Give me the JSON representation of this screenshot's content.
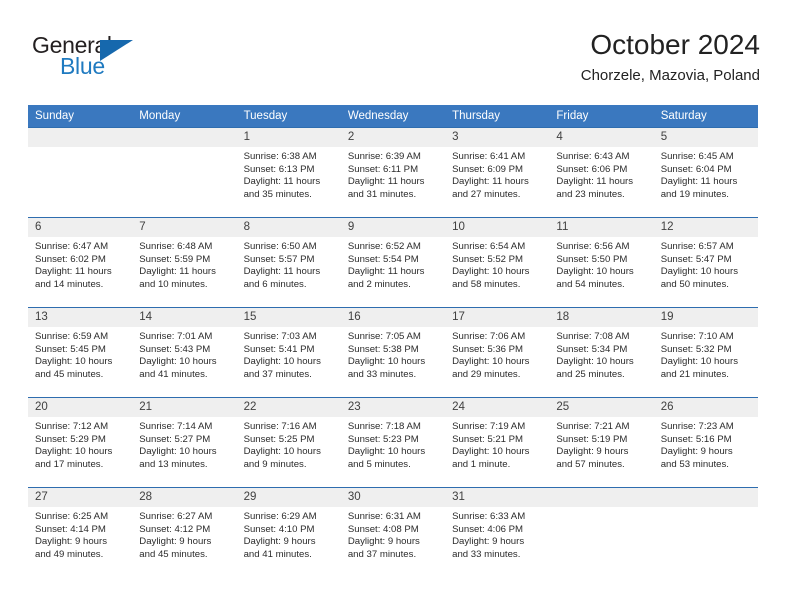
{
  "brand": {
    "name_part1": "General",
    "name_part2": "Blue",
    "flag_icon": "triangle-flag-icon"
  },
  "header": {
    "title": "October 2024",
    "location": "Chorzele, Mazovia, Poland"
  },
  "colors": {
    "header_blue": "#3a78bf",
    "rule_blue": "#2e6daf",
    "day_band": "#efefef",
    "brand_blue": "#1f7ac0"
  },
  "calendar": {
    "weekday_headers": [
      "Sunday",
      "Monday",
      "Tuesday",
      "Wednesday",
      "Thursday",
      "Friday",
      "Saturday"
    ],
    "weeks": [
      [
        {
          "day": "",
          "blank": true
        },
        {
          "day": "",
          "blank": true
        },
        {
          "day": "1",
          "sunrise": "Sunrise: 6:38 AM",
          "sunset": "Sunset: 6:13 PM",
          "daylight_line1": "Daylight: 11 hours",
          "daylight_line2": "and 35 minutes."
        },
        {
          "day": "2",
          "sunrise": "Sunrise: 6:39 AM",
          "sunset": "Sunset: 6:11 PM",
          "daylight_line1": "Daylight: 11 hours",
          "daylight_line2": "and 31 minutes."
        },
        {
          "day": "3",
          "sunrise": "Sunrise: 6:41 AM",
          "sunset": "Sunset: 6:09 PM",
          "daylight_line1": "Daylight: 11 hours",
          "daylight_line2": "and 27 minutes."
        },
        {
          "day": "4",
          "sunrise": "Sunrise: 6:43 AM",
          "sunset": "Sunset: 6:06 PM",
          "daylight_line1": "Daylight: 11 hours",
          "daylight_line2": "and 23 minutes."
        },
        {
          "day": "5",
          "sunrise": "Sunrise: 6:45 AM",
          "sunset": "Sunset: 6:04 PM",
          "daylight_line1": "Daylight: 11 hours",
          "daylight_line2": "and 19 minutes."
        }
      ],
      [
        {
          "day": "6",
          "sunrise": "Sunrise: 6:47 AM",
          "sunset": "Sunset: 6:02 PM",
          "daylight_line1": "Daylight: 11 hours",
          "daylight_line2": "and 14 minutes."
        },
        {
          "day": "7",
          "sunrise": "Sunrise: 6:48 AM",
          "sunset": "Sunset: 5:59 PM",
          "daylight_line1": "Daylight: 11 hours",
          "daylight_line2": "and 10 minutes."
        },
        {
          "day": "8",
          "sunrise": "Sunrise: 6:50 AM",
          "sunset": "Sunset: 5:57 PM",
          "daylight_line1": "Daylight: 11 hours",
          "daylight_line2": "and 6 minutes."
        },
        {
          "day": "9",
          "sunrise": "Sunrise: 6:52 AM",
          "sunset": "Sunset: 5:54 PM",
          "daylight_line1": "Daylight: 11 hours",
          "daylight_line2": "and 2 minutes."
        },
        {
          "day": "10",
          "sunrise": "Sunrise: 6:54 AM",
          "sunset": "Sunset: 5:52 PM",
          "daylight_line1": "Daylight: 10 hours",
          "daylight_line2": "and 58 minutes."
        },
        {
          "day": "11",
          "sunrise": "Sunrise: 6:56 AM",
          "sunset": "Sunset: 5:50 PM",
          "daylight_line1": "Daylight: 10 hours",
          "daylight_line2": "and 54 minutes."
        },
        {
          "day": "12",
          "sunrise": "Sunrise: 6:57 AM",
          "sunset": "Sunset: 5:47 PM",
          "daylight_line1": "Daylight: 10 hours",
          "daylight_line2": "and 50 minutes."
        }
      ],
      [
        {
          "day": "13",
          "sunrise": "Sunrise: 6:59 AM",
          "sunset": "Sunset: 5:45 PM",
          "daylight_line1": "Daylight: 10 hours",
          "daylight_line2": "and 45 minutes."
        },
        {
          "day": "14",
          "sunrise": "Sunrise: 7:01 AM",
          "sunset": "Sunset: 5:43 PM",
          "daylight_line1": "Daylight: 10 hours",
          "daylight_line2": "and 41 minutes."
        },
        {
          "day": "15",
          "sunrise": "Sunrise: 7:03 AM",
          "sunset": "Sunset: 5:41 PM",
          "daylight_line1": "Daylight: 10 hours",
          "daylight_line2": "and 37 minutes."
        },
        {
          "day": "16",
          "sunrise": "Sunrise: 7:05 AM",
          "sunset": "Sunset: 5:38 PM",
          "daylight_line1": "Daylight: 10 hours",
          "daylight_line2": "and 33 minutes."
        },
        {
          "day": "17",
          "sunrise": "Sunrise: 7:06 AM",
          "sunset": "Sunset: 5:36 PM",
          "daylight_line1": "Daylight: 10 hours",
          "daylight_line2": "and 29 minutes."
        },
        {
          "day": "18",
          "sunrise": "Sunrise: 7:08 AM",
          "sunset": "Sunset: 5:34 PM",
          "daylight_line1": "Daylight: 10 hours",
          "daylight_line2": "and 25 minutes."
        },
        {
          "day": "19",
          "sunrise": "Sunrise: 7:10 AM",
          "sunset": "Sunset: 5:32 PM",
          "daylight_line1": "Daylight: 10 hours",
          "daylight_line2": "and 21 minutes."
        }
      ],
      [
        {
          "day": "20",
          "sunrise": "Sunrise: 7:12 AM",
          "sunset": "Sunset: 5:29 PM",
          "daylight_line1": "Daylight: 10 hours",
          "daylight_line2": "and 17 minutes."
        },
        {
          "day": "21",
          "sunrise": "Sunrise: 7:14 AM",
          "sunset": "Sunset: 5:27 PM",
          "daylight_line1": "Daylight: 10 hours",
          "daylight_line2": "and 13 minutes."
        },
        {
          "day": "22",
          "sunrise": "Sunrise: 7:16 AM",
          "sunset": "Sunset: 5:25 PM",
          "daylight_line1": "Daylight: 10 hours",
          "daylight_line2": "and 9 minutes."
        },
        {
          "day": "23",
          "sunrise": "Sunrise: 7:18 AM",
          "sunset": "Sunset: 5:23 PM",
          "daylight_line1": "Daylight: 10 hours",
          "daylight_line2": "and 5 minutes."
        },
        {
          "day": "24",
          "sunrise": "Sunrise: 7:19 AM",
          "sunset": "Sunset: 5:21 PM",
          "daylight_line1": "Daylight: 10 hours",
          "daylight_line2": "and 1 minute."
        },
        {
          "day": "25",
          "sunrise": "Sunrise: 7:21 AM",
          "sunset": "Sunset: 5:19 PM",
          "daylight_line1": "Daylight: 9 hours",
          "daylight_line2": "and 57 minutes."
        },
        {
          "day": "26",
          "sunrise": "Sunrise: 7:23 AM",
          "sunset": "Sunset: 5:16 PM",
          "daylight_line1": "Daylight: 9 hours",
          "daylight_line2": "and 53 minutes."
        }
      ],
      [
        {
          "day": "27",
          "sunrise": "Sunrise: 6:25 AM",
          "sunset": "Sunset: 4:14 PM",
          "daylight_line1": "Daylight: 9 hours",
          "daylight_line2": "and 49 minutes."
        },
        {
          "day": "28",
          "sunrise": "Sunrise: 6:27 AM",
          "sunset": "Sunset: 4:12 PM",
          "daylight_line1": "Daylight: 9 hours",
          "daylight_line2": "and 45 minutes."
        },
        {
          "day": "29",
          "sunrise": "Sunrise: 6:29 AM",
          "sunset": "Sunset: 4:10 PM",
          "daylight_line1": "Daylight: 9 hours",
          "daylight_line2": "and 41 minutes."
        },
        {
          "day": "30",
          "sunrise": "Sunrise: 6:31 AM",
          "sunset": "Sunset: 4:08 PM",
          "daylight_line1": "Daylight: 9 hours",
          "daylight_line2": "and 37 minutes."
        },
        {
          "day": "31",
          "sunrise": "Sunrise: 6:33 AM",
          "sunset": "Sunset: 4:06 PM",
          "daylight_line1": "Daylight: 9 hours",
          "daylight_line2": "and 33 minutes."
        },
        {
          "day": "",
          "blank": true
        },
        {
          "day": "",
          "blank": true
        }
      ]
    ]
  }
}
